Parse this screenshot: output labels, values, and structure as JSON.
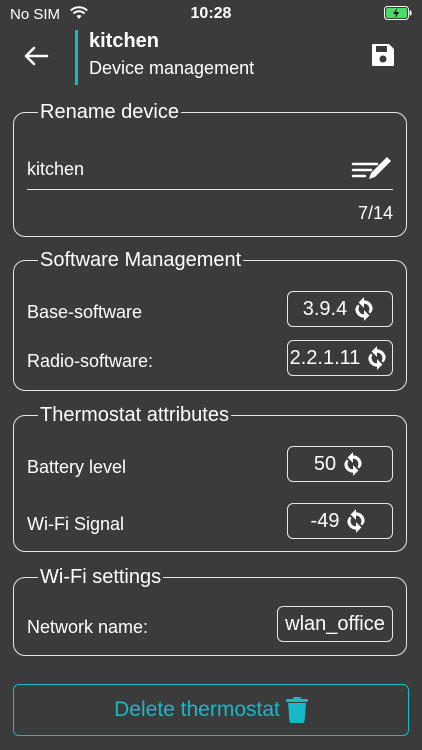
{
  "status_bar": {
    "carrier": "No SIM",
    "time": "10:28"
  },
  "header": {
    "title": "kitchen",
    "subtitle": "Device management"
  },
  "rename": {
    "legend": "Rename device",
    "value": "kitchen",
    "counter": "7/14"
  },
  "software": {
    "legend": "Software Management",
    "base_label": "Base-software",
    "base_value": "3.9.4",
    "radio_label": "Radio-software:",
    "radio_value": "2.2.1.11"
  },
  "attributes": {
    "legend": "Thermostat attributes",
    "battery_label": "Battery level",
    "battery_value": "50",
    "wifi_label": "Wi-Fi Signal",
    "wifi_value": "-49"
  },
  "wifi": {
    "legend": "Wi-Fi settings",
    "network_label": "Network name:",
    "network_value": "wlan_office"
  },
  "delete_label": "Delete thermostat",
  "colors": {
    "accent": "#17b9c7",
    "background": "#3b3b3b",
    "border": "#e6e6e6",
    "battery": "#4cd964"
  }
}
